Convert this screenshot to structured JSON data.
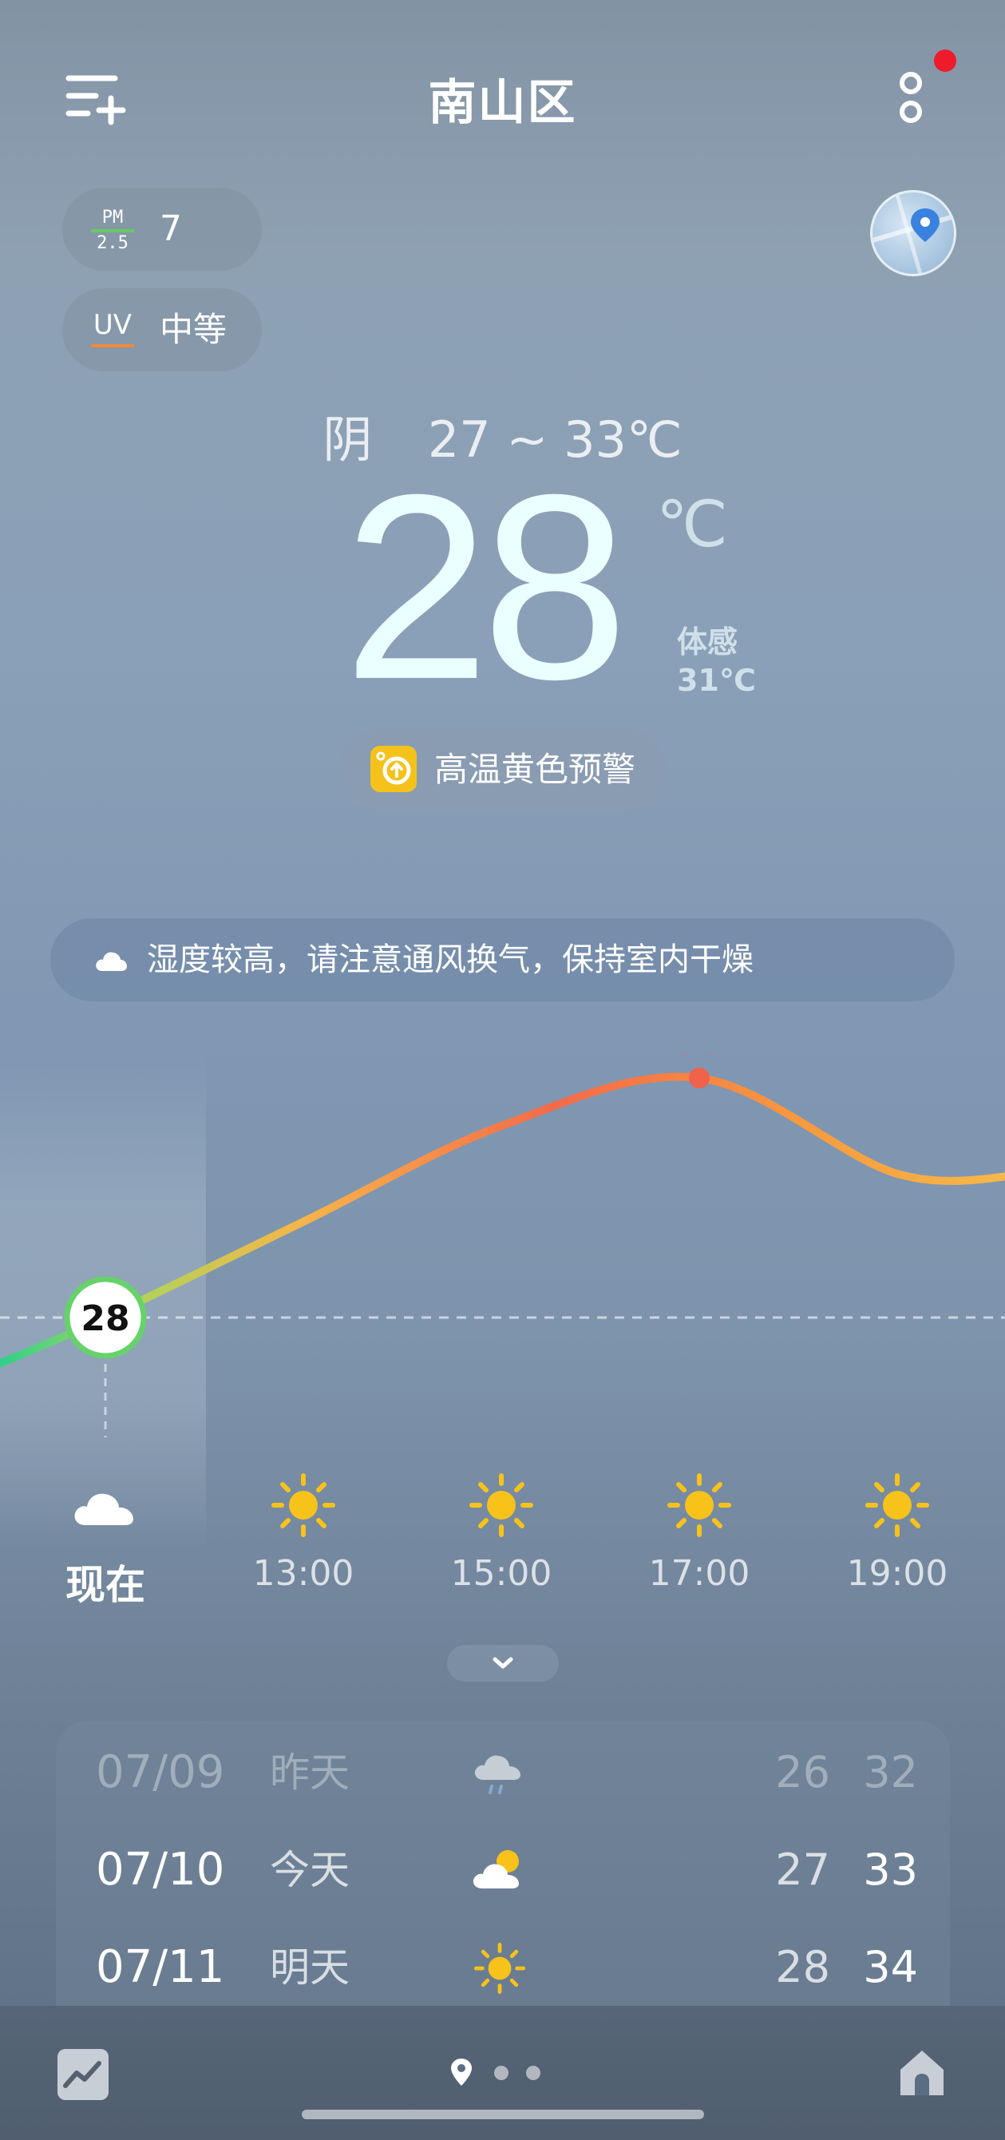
{
  "header": {
    "title": "南山区",
    "add_city_icon": "menu-plus-icon",
    "more_icon": "more-vertical-icon",
    "notification_color": "#ee1b2a"
  },
  "air": {
    "pm_top": "PM",
    "pm_bottom": "2.5",
    "pm_value": "7",
    "uv_label": "UV",
    "uv_value": "中等"
  },
  "current": {
    "condition": "阴",
    "range": "27 ~ 33℃",
    "temp": "28",
    "unit": "℃",
    "feels_label": "体感",
    "feels_value": "31℃",
    "alert": "高温黄色预警",
    "alert_color": "#f4c21b"
  },
  "tip": {
    "text": "湿度较高，请注意通风换气，保持室内干燥"
  },
  "chart_data": {
    "type": "line",
    "x": [
      "现在",
      "13:00",
      "15:00",
      "17:00",
      "19:00"
    ],
    "values": [
      28,
      30,
      32,
      33,
      31
    ],
    "now_label": "28",
    "max_label": "33",
    "max_color": "#f0624a"
  },
  "hourly": [
    {
      "time": "现在",
      "icon": "cloud-icon"
    },
    {
      "time": "13:00",
      "icon": "sun-icon"
    },
    {
      "time": "15:00",
      "icon": "sun-icon"
    },
    {
      "time": "17:00",
      "icon": "sun-icon"
    },
    {
      "time": "19:00",
      "icon": "sun-icon"
    }
  ],
  "daily": [
    {
      "date": "07/09",
      "day": "昨天",
      "icon": "rain-icon",
      "lo": "26",
      "hi": "32"
    },
    {
      "date": "07/10",
      "day": "今天",
      "icon": "partly-cloudy-icon",
      "lo": "27",
      "hi": "33"
    },
    {
      "date": "07/11",
      "day": "明天",
      "icon": "sun-icon",
      "lo": "28",
      "hi": "34"
    }
  ]
}
